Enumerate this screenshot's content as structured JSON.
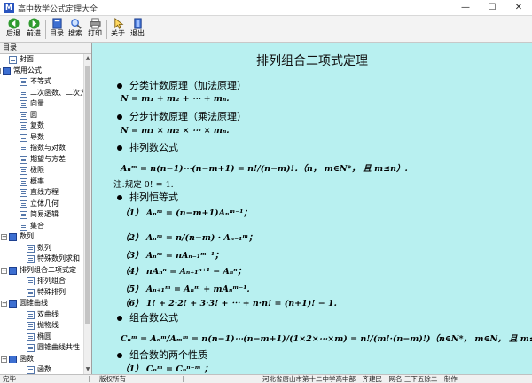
{
  "window": {
    "title": "高中数学公式定理大全",
    "controls": {
      "minimize": "—",
      "maximize": "☐",
      "close": "✕"
    }
  },
  "toolbar": {
    "buttons": [
      {
        "label": "后退",
        "icon": "back-arrow-icon",
        "color": "#2e9a2e"
      },
      {
        "label": "前进",
        "icon": "forward-arrow-icon",
        "color": "#2e9a2e"
      },
      {
        "label": "目录",
        "icon": "contents-book-icon",
        "color": "#3d6fd1"
      },
      {
        "label": "搜索",
        "icon": "search-icon",
        "color": "#3d6fd1"
      },
      {
        "label": "打印",
        "icon": "print-icon",
        "color": "#666666"
      },
      {
        "label": "关于",
        "icon": "about-icon",
        "color": "#d8a020"
      },
      {
        "label": "退出",
        "icon": "exit-icon",
        "color": "#3d6fd1"
      }
    ]
  },
  "sidebar": {
    "header": "目录",
    "items": [
      {
        "label": "封面",
        "level": 1,
        "type": "doc"
      },
      {
        "label": "常用公式",
        "level": 0,
        "type": "book",
        "expand": "−"
      },
      {
        "label": "不等式",
        "level": 2,
        "type": "doc"
      },
      {
        "label": "二次函数、二次方",
        "level": 2,
        "type": "doc"
      },
      {
        "label": "向量",
        "level": 2,
        "type": "doc"
      },
      {
        "label": "圆",
        "level": 2,
        "type": "doc"
      },
      {
        "label": "复数",
        "level": 2,
        "type": "doc"
      },
      {
        "label": "导数",
        "level": 2,
        "type": "doc"
      },
      {
        "label": "指数与对数",
        "level": 2,
        "type": "doc"
      },
      {
        "label": "期望与方差",
        "level": 2,
        "type": "doc"
      },
      {
        "label": "极限",
        "level": 2,
        "type": "doc"
      },
      {
        "label": "概率",
        "level": 2,
        "type": "doc"
      },
      {
        "label": "直线方程",
        "level": 2,
        "type": "doc"
      },
      {
        "label": "立体几何",
        "level": 2,
        "type": "doc"
      },
      {
        "label": "简易逻辑",
        "level": 2,
        "type": "doc"
      },
      {
        "label": "集合",
        "level": 2,
        "type": "doc"
      },
      {
        "label": "数列",
        "level": 1,
        "type": "book",
        "expand": "−"
      },
      {
        "label": "数列",
        "level": 3,
        "type": "doc"
      },
      {
        "label": "特殊数列求和",
        "level": 3,
        "type": "doc"
      },
      {
        "label": "排列组合二项式定",
        "level": 1,
        "type": "book",
        "expand": "−"
      },
      {
        "label": "排列组合",
        "level": 3,
        "type": "doc"
      },
      {
        "label": "特殊排列",
        "level": 3,
        "type": "doc"
      },
      {
        "label": "圆锥曲线",
        "level": 1,
        "type": "book",
        "expand": "−"
      },
      {
        "label": "双曲线",
        "level": 3,
        "type": "doc"
      },
      {
        "label": "抛物线",
        "level": 3,
        "type": "doc"
      },
      {
        "label": "椭圆",
        "level": 3,
        "type": "doc"
      },
      {
        "label": "圆锥曲线共性",
        "level": 3,
        "type": "doc"
      },
      {
        "label": "函数",
        "level": 1,
        "type": "book",
        "expand": "−"
      },
      {
        "label": "函数",
        "level": 3,
        "type": "doc"
      },
      {
        "label": "图像",
        "level": 3,
        "type": "doc"
      }
    ]
  },
  "content": {
    "title": "排列组合二项式定理",
    "lines": [
      {
        "kind": "heading",
        "text": "分类计数原理（加法原理）"
      },
      {
        "kind": "formula",
        "text": "N = m₁ + m₂ + ⋯ + mₙ."
      },
      {
        "kind": "heading",
        "text": "分步计数原理（乘法原理）"
      },
      {
        "kind": "formula",
        "text": "N = m₁ × m₂ × ⋯ × mₙ."
      },
      {
        "kind": "heading",
        "text": "排列数公式"
      },
      {
        "kind": "formula",
        "text": "Aₙᵐ = n(n−1)⋯(n−m+1) = n!/(n−m)!．（n， m∈N*， 且 m≤n）."
      },
      {
        "kind": "note",
        "text": "注:规定 0! = 1."
      },
      {
        "kind": "heading",
        "text": "排列恒等式"
      },
      {
        "kind": "formula",
        "text": "（1） Aₙᵐ = (n−m+1)Aₙᵐ⁻¹；"
      },
      {
        "kind": "formula",
        "text": "（2） Aₙᵐ = n/(n−m) · Aₙ₋₁ᵐ；"
      },
      {
        "kind": "formula",
        "text": "（3） Aₙᵐ = nAₙ₋₁ᵐ⁻¹；"
      },
      {
        "kind": "formula",
        "text": "（4） nAₙⁿ = Aₙ₊₁ⁿ⁺¹ − Aₙⁿ；"
      },
      {
        "kind": "formula",
        "text": "（5） Aₙ₊₁ᵐ = Aₙᵐ + mAₙᵐ⁻¹."
      },
      {
        "kind": "formula",
        "text": "（6） 1! + 2·2! + 3·3! + ⋯ + n·n! = (n+1)! − 1."
      },
      {
        "kind": "heading",
        "text": "组合数公式"
      },
      {
        "kind": "formula",
        "text": "Cₙᵐ = Aₙᵐ/Aₘᵐ = n(n−1)⋯(n−m+1)/(1×2×⋯×m) = n!/(m!·(n−m)!)（n∈N*， m∈N， 且 m≤n）."
      },
      {
        "kind": "heading",
        "text": "组合数的两个性质"
      },
      {
        "kind": "formula",
        "text": "（1） Cₙᵐ = Cₙⁿ⁻ᵐ ；"
      }
    ]
  },
  "status": {
    "state": "完毕",
    "copyright": "版权所有",
    "author": "河北省唐山市第十二中学高中部　齐建民　网名 三下五除二　制作"
  }
}
